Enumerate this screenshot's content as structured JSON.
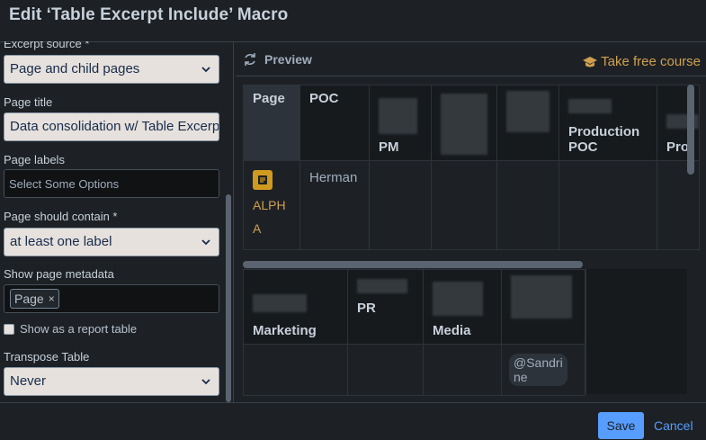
{
  "dialog": {
    "title": "Edit ‘Table Excerpt Include’ Macro"
  },
  "form": {
    "excerpt_source": {
      "label": "Excerpt source *",
      "value": "Page and child pages"
    },
    "page_title": {
      "label": "Page title",
      "value": "Data consolidation w/ Table Excerpt"
    },
    "page_labels": {
      "label": "Page labels",
      "placeholder": "Select Some Options"
    },
    "page_contain": {
      "label": "Page should contain *",
      "value": "at least one label"
    },
    "show_metadata": {
      "label": "Show page metadata",
      "chip": "Page",
      "chip_remove": "×"
    },
    "report_table": {
      "label": "Show as a report table"
    },
    "transpose": {
      "label": "Transpose Table",
      "value": "Never"
    }
  },
  "preview": {
    "title": "Preview",
    "course_link": "Take free course",
    "table1": {
      "headers": [
        "Page",
        "POC",
        "PM",
        "",
        "",
        "Production POC",
        "Pro"
      ],
      "row": {
        "page_link": "ALPHA",
        "page_link_line1": "ALPH",
        "page_link_line2": "A",
        "poc": "Herman"
      }
    },
    "table2": {
      "headers": [
        "Marketing",
        "PR",
        "Media",
        ""
      ],
      "mention_line1": "@Sandri",
      "mention_line2": "ne"
    }
  },
  "footer": {
    "save": "Save",
    "cancel": "Cancel"
  }
}
